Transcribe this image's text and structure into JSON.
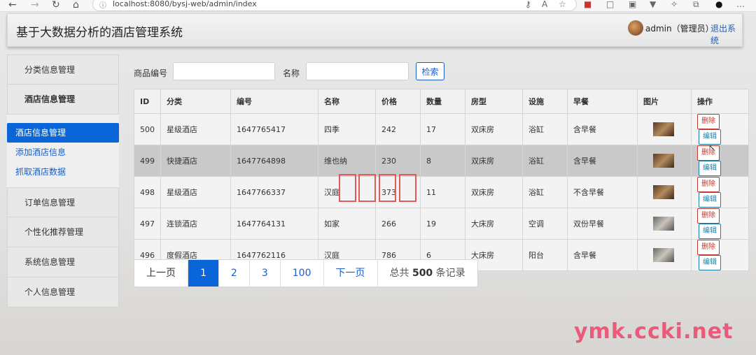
{
  "browser": {
    "url": "localhost:8080/bysj-web/admin/index"
  },
  "header": {
    "title": "基于大数据分析的酒店管理系统",
    "user": "admin（管理员）",
    "logout": "退出系统"
  },
  "sidebar": {
    "top_items": [
      "分类信息管理",
      "酒店信息管理"
    ],
    "sub_items": [
      "酒店信息管理",
      "添加酒店信息",
      "抓取酒店数据"
    ],
    "bottom_items": [
      "订单信息管理",
      "个性化推荐管理",
      "系统信息管理",
      "个人信息管理"
    ]
  },
  "search": {
    "code_label": "商品编号",
    "name_label": "名称",
    "button": "检索"
  },
  "table": {
    "headers": [
      "ID",
      "分类",
      "编号",
      "名称",
      "价格",
      "数量",
      "房型",
      "设施",
      "早餐",
      "图片",
      "操作"
    ],
    "rows": [
      {
        "id": "500",
        "category": "星级酒店",
        "code": "1647765417",
        "name": "四季",
        "price": "242",
        "qty": "17",
        "room": "双床房",
        "facility": "浴缸",
        "breakfast": "含早餐",
        "img": "warm"
      },
      {
        "id": "499",
        "category": "快捷酒店",
        "code": "1647764898",
        "name": "维也纳",
        "price": "230",
        "qty": "8",
        "room": "双床房",
        "facility": "浴缸",
        "breakfast": "含早餐",
        "img": "warm"
      },
      {
        "id": "498",
        "category": "星级酒店",
        "code": "1647766337",
        "name": "汉庭",
        "price": "373",
        "qty": "11",
        "room": "双床房",
        "facility": "浴缸",
        "breakfast": "不含早餐",
        "img": "warm"
      },
      {
        "id": "497",
        "category": "连锁酒店",
        "code": "1647764131",
        "name": "如家",
        "price": "266",
        "qty": "19",
        "room": "大床房",
        "facility": "空调",
        "breakfast": "双份早餐",
        "img": "cool"
      },
      {
        "id": "496",
        "category": "度假酒店",
        "code": "1647762116",
        "name": "汉庭",
        "price": "786",
        "qty": "6",
        "room": "大床房",
        "facility": "阳台",
        "breakfast": "含早餐",
        "img": "cool"
      }
    ],
    "delete_label": "删除",
    "edit_label": "编辑"
  },
  "pagination": {
    "prev": "上一页",
    "pages": [
      "1",
      "2",
      "3",
      "100"
    ],
    "next": "下一页",
    "total_prefix": "总共 ",
    "total": "500",
    "total_suffix": " 条记录"
  },
  "watermark": "ymk.ccki.net",
  "colors": {
    "accent": "#0a66d8",
    "link": "#1a5fc4",
    "delete": "#c0392b",
    "edit": "#1f7fa3"
  }
}
